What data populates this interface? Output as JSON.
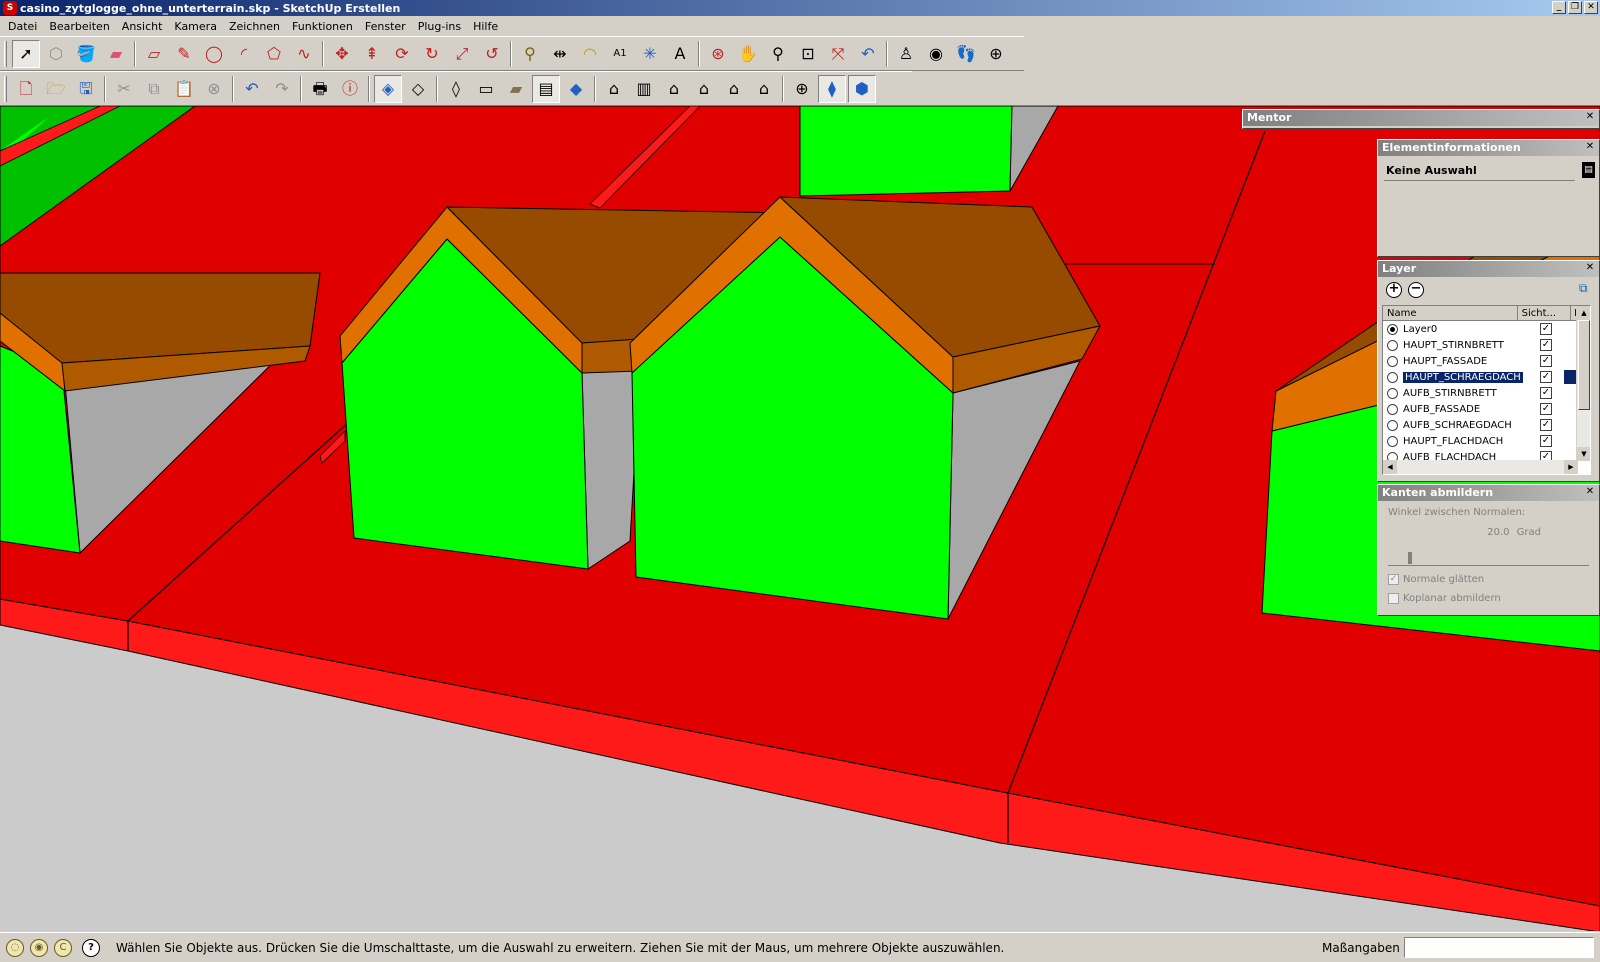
{
  "window": {
    "title": "casino_zytglogge_ohne_unterterrain.skp - SketchUp Erstellen",
    "app_icon": "sketchup-icon",
    "controls": [
      "minimize-icon",
      "restore-icon",
      "close-icon"
    ]
  },
  "menu": [
    "Datei",
    "Bearbeiten",
    "Ansicht",
    "Kamera",
    "Zeichnen",
    "Funktionen",
    "Fenster",
    "Plug-ins",
    "Hilfe"
  ],
  "toolbar_main": [
    "select-arrow-icon",
    "make-component-icon",
    "paint-bucket-icon",
    "eraser-icon",
    "rectangle-icon",
    "pencil-line-icon",
    "circle-icon",
    "arc-icon",
    "polygon-icon",
    "freehand-icon",
    "move-icon",
    "push-pull-icon",
    "rotate-icon",
    "follow-me-icon",
    "scale-icon",
    "offset-icon",
    "tape-measure-icon",
    "dimension-icon",
    "protractor-icon",
    "text-icon",
    "axes-icon",
    "3d-text-icon",
    "orbit-icon",
    "pan-icon",
    "zoom-icon",
    "zoom-window-icon",
    "zoom-extents-icon",
    "previous-view-icon",
    "position-camera-icon",
    "look-around-icon",
    "walk-icon",
    "section-plane-icon"
  ],
  "toolbar_secondary": [
    "new-file-icon",
    "open-file-icon",
    "save-file-icon",
    "cut-icon",
    "copy-icon",
    "paste-icon",
    "delete-icon",
    "undo-icon",
    "redo-icon",
    "print-icon",
    "model-info-icon",
    "xray-icon",
    "back-edges-icon",
    "wireframe-icon",
    "hidden-line-icon",
    "shaded-icon",
    "shaded-textures-icon",
    "monochrome-icon",
    "iso-view-icon",
    "top-view-icon",
    "front-view-icon",
    "right-view-icon",
    "back-view-icon",
    "left-view-icon",
    "display-section-planes-icon",
    "display-section-cuts-icon",
    "section-fill-icon"
  ],
  "panels": {
    "mentor": {
      "title": "Mentor"
    },
    "entity_info": {
      "title": "Elementinformationen",
      "selection": "Keine Auswahl"
    },
    "layers": {
      "title": "Layer",
      "columns": {
        "name": "Name",
        "visible": "Sicht...",
        "color": "Fa"
      },
      "rows": [
        {
          "name": "Layer0",
          "visible": true,
          "current": true,
          "selected": false
        },
        {
          "name": "HAUPT_STIRNBRETT",
          "visible": true,
          "current": false,
          "selected": false
        },
        {
          "name": "HAUPT_FASSADE",
          "visible": true,
          "current": false,
          "selected": false
        },
        {
          "name": "HAUPT_SCHRAEGDACH",
          "visible": true,
          "current": false,
          "selected": true
        },
        {
          "name": "AUFB_STIRNBRETT",
          "visible": true,
          "current": false,
          "selected": false
        },
        {
          "name": "AUFB_FASSADE",
          "visible": true,
          "current": false,
          "selected": false
        },
        {
          "name": "AUFB_SCHRAEGDACH",
          "visible": true,
          "current": false,
          "selected": false
        },
        {
          "name": "HAUPT_FLACHDACH",
          "visible": true,
          "current": false,
          "selected": false
        },
        {
          "name": "AUFB_FLACHDACH",
          "visible": true,
          "current": false,
          "selected": false
        }
      ]
    },
    "soften": {
      "title": "Kanten abmildern",
      "angle_label": "Winkel zwischen Normalen:",
      "angle_value": "20.0",
      "angle_unit": "Grad",
      "angle_fraction": 0.11,
      "smooth_normals_label": "Normale glätten",
      "smooth_normals_checked": true,
      "soften_coplanar_label": "Koplanar abmildern",
      "soften_coplanar_checked": false
    }
  },
  "status": {
    "message": "Wählen Sie Objekte aus. Drücken Sie die Umschalttaste, um die Auswahl zu erweitern. Ziehen Sie mit der Maus, um mehrere Objekte auszuwählen.",
    "measurements_label": "Maßangaben",
    "measurements_value": ""
  },
  "scene_colors": {
    "ground": "#cbcbcb",
    "terrain": "#e00000",
    "terrain_edge": "#ff1a1a",
    "facade": "#00ff00",
    "facade_dark": "#00c000",
    "roof": "#964b00",
    "fascia": "#e07000",
    "side_wall": "#a8a8a8"
  }
}
